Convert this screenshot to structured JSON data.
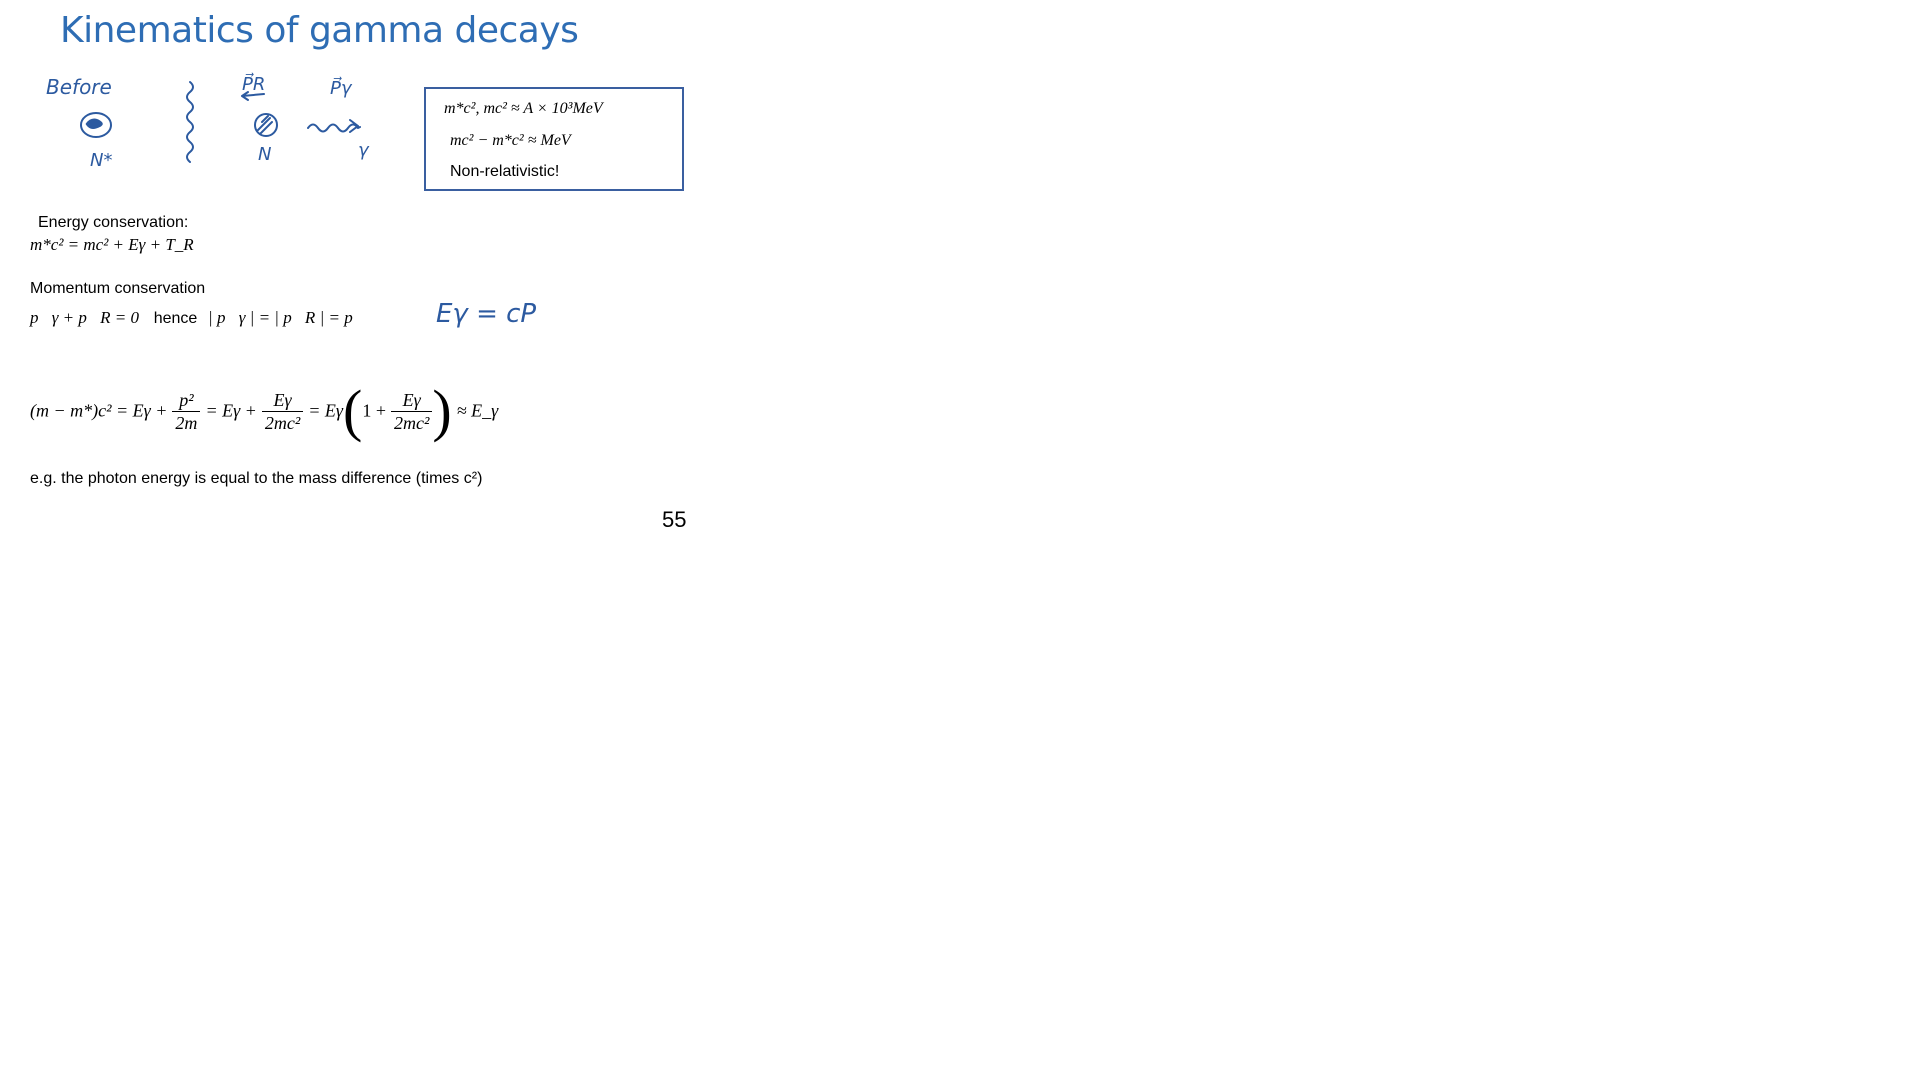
{
  "slide": {
    "title": "Kinematics of gamma decays",
    "page_number": "55"
  },
  "sketch": {
    "before_label": "Before",
    "nucleus_excited_label": "N*",
    "nucleus_label": "N",
    "pr_label": "P⃗R",
    "pgamma_label": "P⃗γ",
    "gamma_label": "γ",
    "handwritten_relation": "Eγ = cP"
  },
  "box": {
    "line1": "m*c²,  mc² ≈ A × 10³MeV",
    "line2": "mc²  − m*c² ≈ MeV",
    "line3": "Non-relativistic!"
  },
  "energy": {
    "heading": "Energy conservation:",
    "equation": "m*c² =  mc² + Eγ + T_R"
  },
  "momentum": {
    "heading": "Momentum conservation",
    "eq_part1": "p⃗γ + p⃗R = 0",
    "hence": "hence",
    "eq_part2": "| p⃗γ | = | p⃗R | = p"
  },
  "main_equation": {
    "lhs": "(m − m*)c² = Eγ +",
    "frac1_num": "p²",
    "frac1_den": "2m",
    "mid": "= Eγ +",
    "frac2_num": "Eγ",
    "frac2_den": "2mc²",
    "mid2": "= Eγ",
    "paren_inner": "1 +",
    "frac3_num": "Eγ",
    "frac3_den": "2mc²",
    "rhs": "≈ E_γ"
  },
  "conclusion": "e.g. the photon energy is equal to the mass difference (times c²)"
}
